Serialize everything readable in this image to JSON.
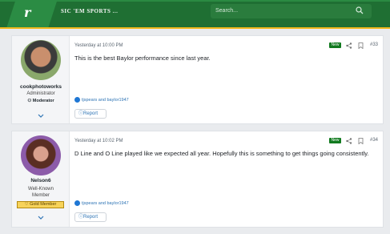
{
  "header": {
    "logo_letter": "r",
    "brand_text": "SIC 'EM SPORTS",
    "brand_suffix": "...",
    "search_placeholder": "Search..."
  },
  "posts": [
    {
      "author": "cookphotoworks",
      "user_title": "Administrator",
      "role": "Moderator",
      "time": "Yesterday at 10:00 PM",
      "badge": "New",
      "number": "#33",
      "text": "This is the best Baylor performance since last year.",
      "reactions": "tjspears and baylor1947",
      "report_label": "Report"
    },
    {
      "author": "Nelson6",
      "user_title_line1": "Well-Known",
      "user_title_line2": "Member",
      "gold_label": "Gold Member",
      "time": "Yesterday at 10:02 PM",
      "badge": "New",
      "number": "#34",
      "text": "D Line and O Line played like we expected all year. Hopefully this is something to get things going consistently.",
      "reactions": "tjspears and baylor1947",
      "report_label": "Report"
    }
  ],
  "colors": {
    "header_green": "#1f6f33",
    "accent_gold": "#f0b81c",
    "new_badge": "#117a1f",
    "link_blue": "#2e74b5"
  },
  "icons": [
    "search-icon",
    "share-icon",
    "bookmark-icon",
    "chevron-down-icon",
    "reaction-icon",
    "report-icon"
  ]
}
